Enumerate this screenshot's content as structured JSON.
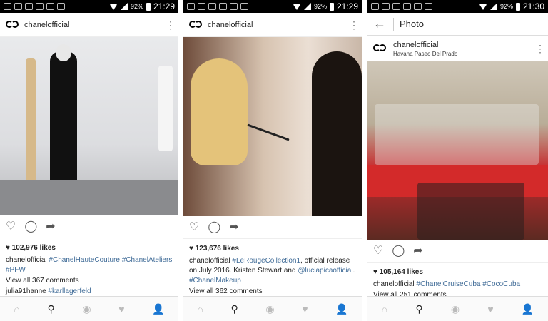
{
  "status": [
    {
      "battery": "92%",
      "time": "21:29"
    },
    {
      "battery": "92%",
      "time": "21:29"
    },
    {
      "battery": "92%",
      "time": "21:30"
    }
  ],
  "posts": [
    {
      "username": "chanelofficial",
      "likes": "102,976 likes",
      "caption_user": "chanelofficial",
      "caption_text": "",
      "hashtags": [
        "#ChanelHauteCouture",
        "#ChanelAteliers",
        "#PFW"
      ],
      "view_comments": "View all 367 comments",
      "comment_user": "julia91hanne",
      "comment_text": "#karllagerfeld"
    },
    {
      "username": "chanelofficial",
      "likes": "123,676 likes",
      "caption_user": "chanelofficial",
      "caption_parts": [
        "#LeRougeCollection1",
        ", official release on July 2016. Kristen Stewart and ",
        "@luciapicaofficial",
        ". ",
        "#ChanelMakeup"
      ],
      "view_comments": "View all 362 comments"
    },
    {
      "page_title": "Photo",
      "username": "chanelofficial",
      "location": "Havana Paseo Del Prado",
      "likes": "105,164 likes",
      "caption_user": "chanelofficial",
      "hashtags": [
        "#ChanelCruiseCuba",
        "#CocoCuba"
      ],
      "view_comments": "View all 251 comments"
    }
  ],
  "icons": {
    "heart": "♡",
    "comment": "◯",
    "share": "➦",
    "kebab": "⋮",
    "back": "←",
    "nav": [
      "⌂",
      "⚲",
      "◉",
      "♥",
      "👤"
    ]
  },
  "colors": {
    "hashtag": "#3f6b97",
    "muted": "#999999"
  }
}
